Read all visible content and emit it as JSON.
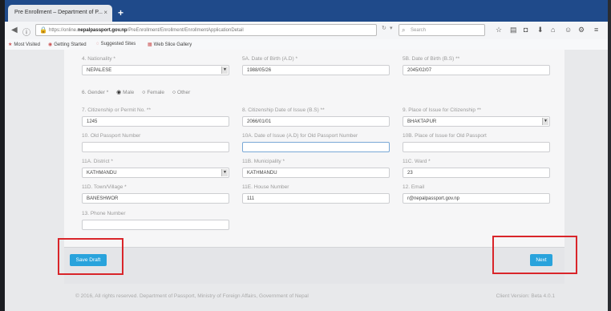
{
  "browser": {
    "tab_title": "Pre Enrollment – Department of P...",
    "tab_close": "×",
    "new_tab": "+",
    "url_prefix": "https://online.",
    "url_domain": "nepalpassport.gov.np",
    "url_rest": "/PreEnrollment/Enrollment/EnrollmentApplicationDetail",
    "search_placeholder": "Search",
    "bookmarks": [
      "Most Visited",
      "Getting Started",
      "Suggested Sites",
      "Web Slice Gallery"
    ]
  },
  "form": {
    "nationality": {
      "label": "4. Nationality *",
      "value": "NEPALESE"
    },
    "dob_ad": {
      "label": "5A. Date of Birth (A.D) *",
      "value": "1988/05/26"
    },
    "dob_bs": {
      "label": "5B. Date of Birth (B.S) **",
      "value": "2045/02/07"
    },
    "gender": {
      "label": "6. Gender *",
      "options": [
        "Male",
        "Female",
        "Other"
      ],
      "selected": "Male"
    },
    "citizenship_no": {
      "label": "7. Citizenship or Permit No. **",
      "value": "1245"
    },
    "citizenship_issue_date": {
      "label": "8. Citizenship Date of Issue (B.S) **",
      "value": "2066/01/01"
    },
    "citizenship_issue_place": {
      "label": "9. Place of Issue for Citizenship **",
      "value": "BHAKTAPUR"
    },
    "old_passport_no": {
      "label": "10. Old Passport Number",
      "value": ""
    },
    "old_passport_issue_date": {
      "label": "10A. Date of Issue (A.D) for Old Passport Number",
      "value": ""
    },
    "old_passport_issue_place": {
      "label": "10B. Place of Issue for Old Passport",
      "value": ""
    },
    "district": {
      "label": "11A. District *",
      "value": "KATHMANDU"
    },
    "municipality": {
      "label": "11B. Municipality *",
      "value": "KATHMANDU"
    },
    "ward": {
      "label": "11C. Ward *",
      "value": "23"
    },
    "town": {
      "label": "11D. Town/Village *",
      "value": "BANESHWOR"
    },
    "house_no": {
      "label": "11E. House Number",
      "value": "111"
    },
    "email": {
      "label": "12. Email",
      "value": "r@nepalpassport.gov.np"
    },
    "phone": {
      "label": "13. Phone Number",
      "value": ""
    }
  },
  "actions": {
    "save_draft": "Save Draft",
    "next": "Next"
  },
  "footer": {
    "copyright": "© 2016, All rights reserved. Department of Passport, Ministry of Foreign Affairs, Government of Nepal",
    "version": "Client Version: Beta 4.0.1"
  }
}
